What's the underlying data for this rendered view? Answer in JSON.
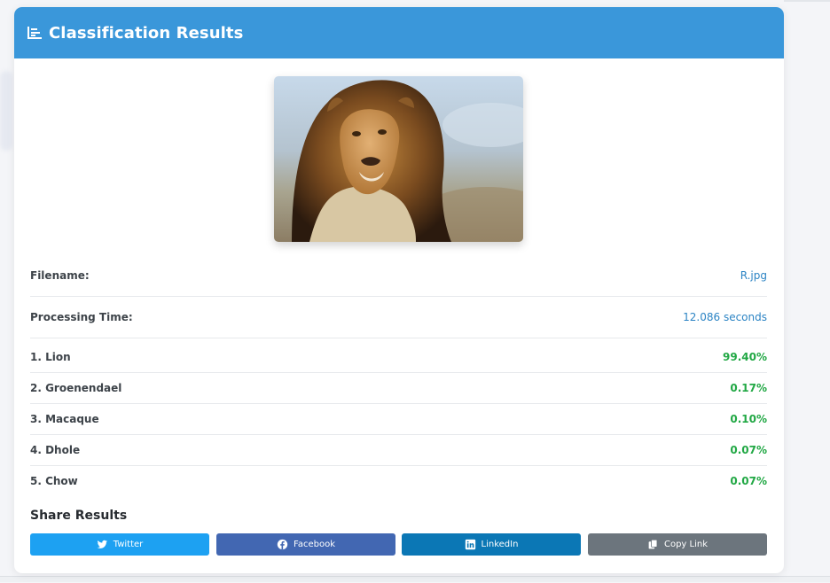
{
  "header": {
    "title": "Classification Results",
    "icon": "bar-chart-icon"
  },
  "image": {
    "alt": "Lion"
  },
  "info": [
    {
      "label": "Filename:",
      "value": "R.jpg"
    },
    {
      "label": "Processing Time:",
      "value": "12.086 seconds"
    }
  ],
  "predictions": [
    {
      "label": "1. Lion",
      "value": "99.40%"
    },
    {
      "label": "2. Groenendael",
      "value": "0.17%"
    },
    {
      "label": "3. Macaque",
      "value": "0.10%"
    },
    {
      "label": "4. Dhole",
      "value": "0.07%"
    },
    {
      "label": "5. Chow",
      "value": "0.07%"
    }
  ],
  "share": {
    "title": "Share Results",
    "buttons": [
      {
        "label": "Twitter",
        "icon": "twitter-icon",
        "color": "#1da1f2"
      },
      {
        "label": "Facebook",
        "icon": "facebook-icon",
        "color": "#4267b2"
      },
      {
        "label": "LinkedIn",
        "icon": "linkedin-icon",
        "color": "#0b77b5"
      },
      {
        "label": "Copy Link",
        "icon": "copy-icon",
        "color": "#6c757d"
      }
    ]
  },
  "colors": {
    "header": "#3a97da",
    "value_link": "#2c84c4",
    "confidence": "#22a845"
  }
}
